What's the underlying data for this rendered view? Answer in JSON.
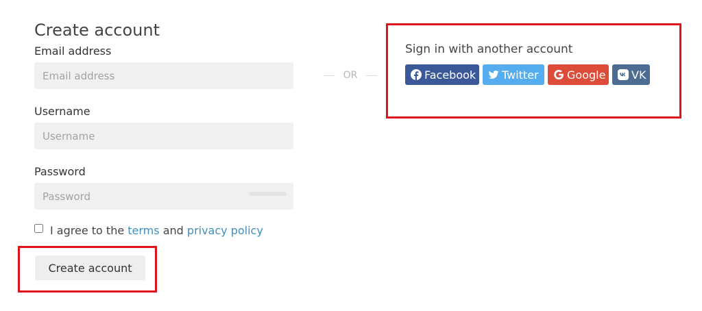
{
  "form": {
    "title": "Create account",
    "email": {
      "label": "Email address",
      "placeholder": "Email address"
    },
    "username": {
      "label": "Username",
      "placeholder": "Username"
    },
    "password": {
      "label": "Password",
      "placeholder": "Password"
    },
    "agree": {
      "prefix": "I agree to the",
      "terms_link": "terms",
      "conjunction": "and",
      "privacy_link": "privacy policy"
    },
    "submit_label": "Create account"
  },
  "divider": {
    "label": "OR"
  },
  "social": {
    "heading": "Sign in with another account",
    "buttons": [
      {
        "label": "Facebook",
        "icon": "facebook-icon",
        "color": "#3b5998"
      },
      {
        "label": "Twitter",
        "icon": "twitter-icon",
        "color": "#55acee"
      },
      {
        "label": "Google",
        "icon": "google-icon",
        "color": "#dd4b39"
      },
      {
        "label": "VK",
        "icon": "vk-icon",
        "color": "#4c6c91"
      }
    ]
  },
  "annotations": {
    "highlight_color": "#e0121b"
  }
}
